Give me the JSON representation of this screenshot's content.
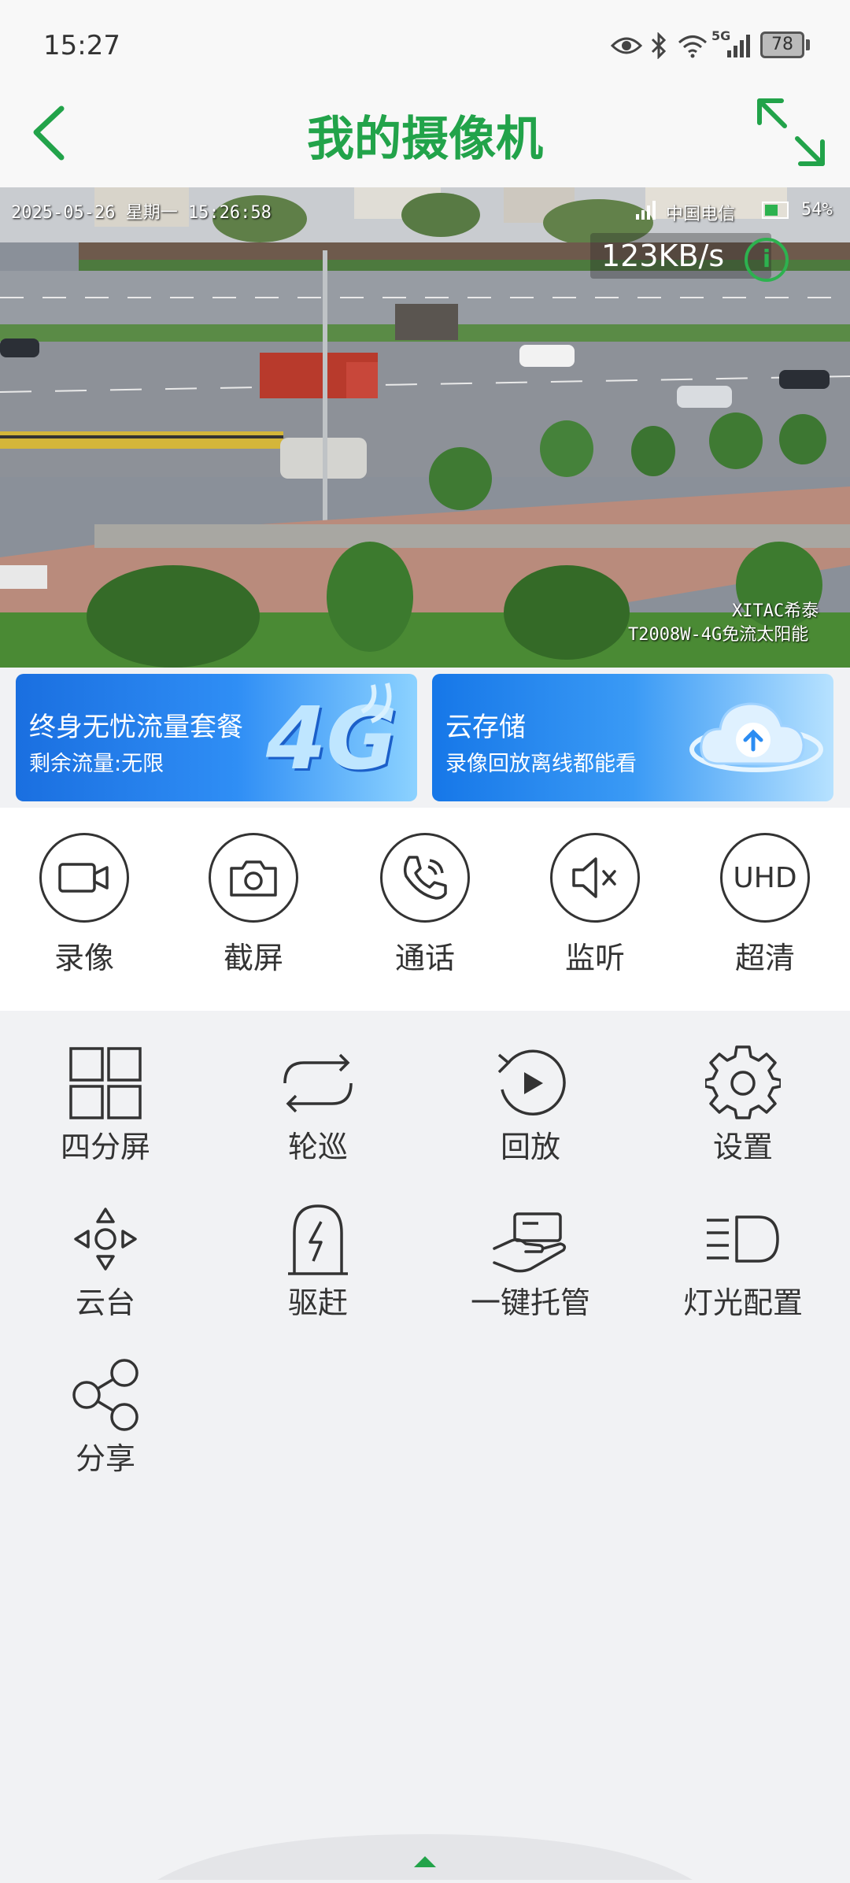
{
  "status_bar": {
    "time": "15:27",
    "battery": "78",
    "network": "5G",
    "icons": [
      "eye-icon",
      "bluetooth-icon",
      "wifi-icon",
      "cellular-signal-icon",
      "battery-icon"
    ]
  },
  "header": {
    "title": "我的摄像机",
    "back_icon": "chevron-left-icon",
    "fullscreen_icon": "expand-icon"
  },
  "video": {
    "osd_datetime": "2025-05-26 星期一 15:26:58",
    "osd_carrier": "中国电信",
    "osd_signal_pct": "54%",
    "osd_brand": "XITAC希泰",
    "osd_model": "T2008W-4G免流太阳能",
    "bitrate": "123KB/s"
  },
  "banners": [
    {
      "title": "终身无忧流量套餐",
      "subtitle": "剩余流量:无限",
      "art_text": "4G"
    },
    {
      "title": "云存储",
      "subtitle": "录像回放离线都能看"
    }
  ],
  "quick_actions": [
    {
      "label": "录像",
      "icon": "video-camera-icon"
    },
    {
      "label": "截屏",
      "icon": "camera-icon"
    },
    {
      "label": "通话",
      "icon": "phone-call-icon"
    },
    {
      "label": "监听",
      "icon": "speaker-mute-icon"
    },
    {
      "label": "超清",
      "icon": "uhd-icon",
      "icon_text": "UHD"
    }
  ],
  "functions": [
    {
      "label": "四分屏",
      "icon": "grid-four-icon"
    },
    {
      "label": "轮巡",
      "icon": "loop-arrows-icon"
    },
    {
      "label": "回放",
      "icon": "playback-icon"
    },
    {
      "label": "设置",
      "icon": "gear-icon"
    },
    {
      "label": "云台",
      "icon": "ptz-direction-icon"
    },
    {
      "label": "驱赶",
      "icon": "lightning-alarm-icon"
    },
    {
      "label": "一键托管",
      "icon": "hand-card-icon"
    },
    {
      "label": "灯光配置",
      "icon": "light-beam-icon"
    },
    {
      "label": "分享",
      "icon": "share-icon"
    }
  ],
  "colors": {
    "accent": "#22a34a",
    "background": "#f1f2f4"
  }
}
